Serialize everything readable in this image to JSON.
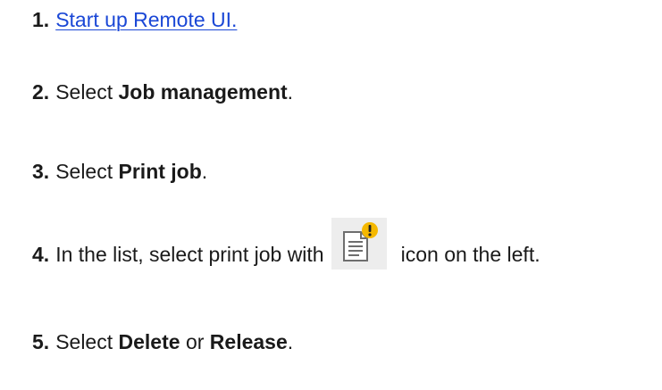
{
  "steps": [
    {
      "number": "1.",
      "link_text": "Start up Remote UI."
    },
    {
      "number": "2.",
      "prefix": "Select ",
      "bold": "Job management",
      "suffix": "."
    },
    {
      "number": "3.",
      "prefix": "Select ",
      "bold": "Print job",
      "suffix": "."
    },
    {
      "number": "4.",
      "prefix": "In the list, select print job with",
      "icon": "print-job-warning-icon",
      "suffix": "icon on the left."
    },
    {
      "number": "5.",
      "prefix": "Select ",
      "bold": "Delete",
      "middle": " or ",
      "bold2": "Release",
      "suffix": "."
    }
  ],
  "colors": {
    "link": "#1a47d6",
    "warning": "#f5b800"
  }
}
